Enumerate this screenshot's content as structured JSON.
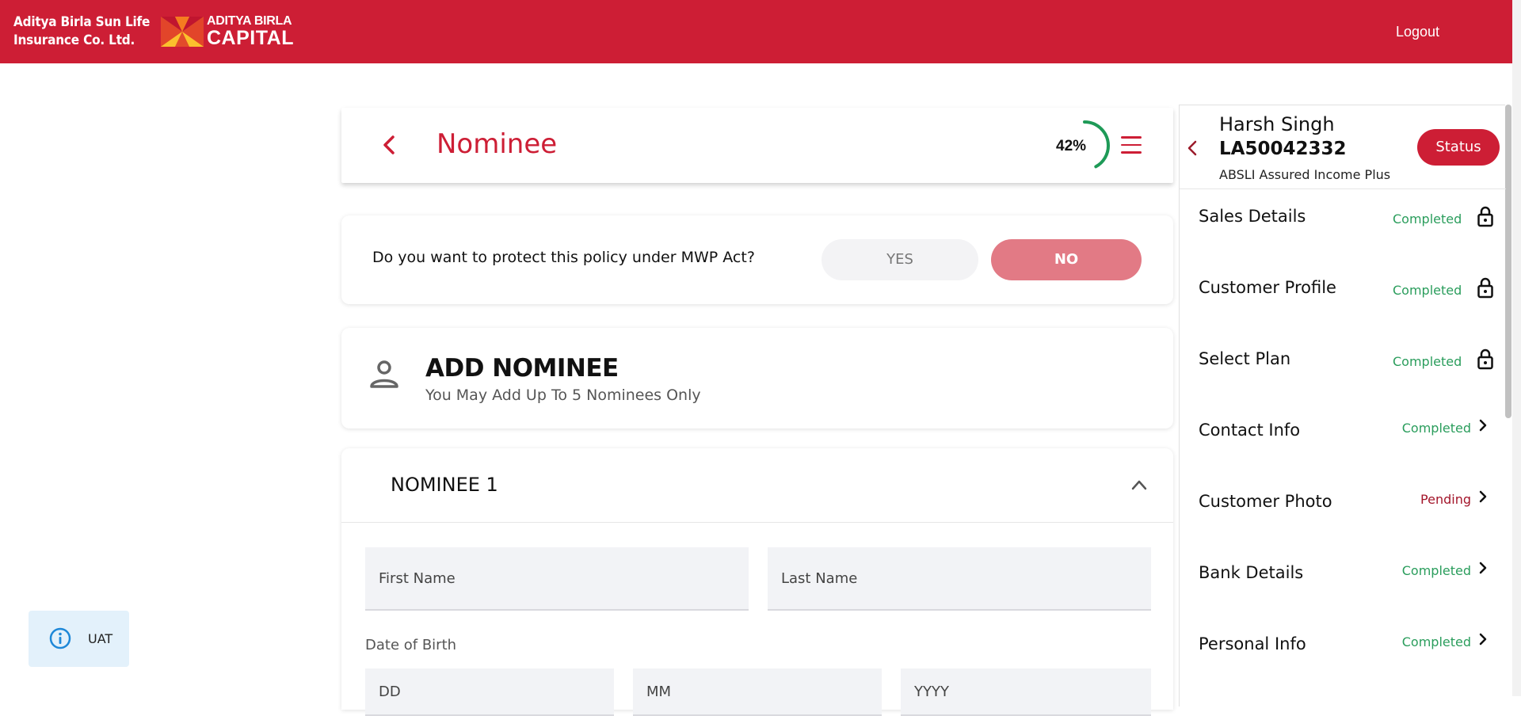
{
  "header": {
    "brand_line1": "Aditya Birla Sun Life",
    "brand_line2": "Insurance Co. Ltd.",
    "logo_word1": "ADITYA BIRLA",
    "logo_word2": "CAPITAL",
    "logout_label": "Logout",
    "brand_color": "#cd1e35"
  },
  "page": {
    "title": "Nominee",
    "progress_value": 42,
    "progress_label": "42%"
  },
  "mwp": {
    "question": "Do you want to protect this policy under MWP Act?",
    "yes_label": "YES",
    "no_label": "NO",
    "selected": "NO"
  },
  "add_nominee": {
    "title": "ADD NOMINEE",
    "subtitle": "You May Add Up To 5 Nominees Only"
  },
  "nominee1": {
    "title": "NOMINEE 1",
    "first_name_placeholder": "First Name",
    "last_name_placeholder": "Last Name",
    "dob_label": "Date of Birth",
    "dd_placeholder": "DD",
    "mm_placeholder": "MM",
    "yyyy_placeholder": "YYYY"
  },
  "side_panel": {
    "customer_name": "Harsh Singh",
    "policy_number": "LA50042332",
    "plan_name": "ABSLI Assured Income Plus",
    "status_button": "Status",
    "steps": [
      {
        "label": "Sales Details",
        "status": "Completed",
        "locked": true
      },
      {
        "label": "Customer Profile",
        "status": "Completed",
        "locked": true
      },
      {
        "label": "Select Plan",
        "status": "Completed",
        "locked": true
      },
      {
        "label": "Contact Info",
        "status": "Completed",
        "locked": false
      },
      {
        "label": "Customer Photo",
        "status": "Pending",
        "locked": false
      },
      {
        "label": "Bank Details",
        "status": "Completed",
        "locked": false
      },
      {
        "label": "Personal Info",
        "status": "Completed",
        "locked": false
      }
    ]
  },
  "env_badge": {
    "label": "UAT"
  },
  "colors": {
    "completed": "#2a9d5c",
    "pending": "#a3152a",
    "progress": "#1e9a57"
  }
}
